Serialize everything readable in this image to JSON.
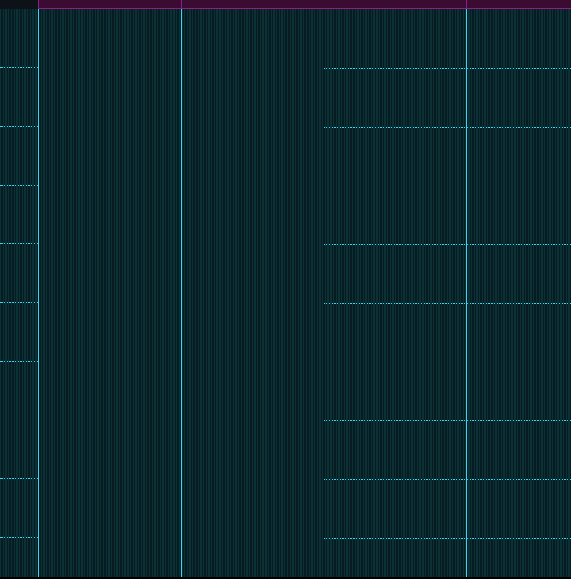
{
  "grid": {
    "columns": 5,
    "rows_in_left_gutter": 10,
    "rows_in_right_panes": 9,
    "colors": {
      "background": "#082428",
      "hatch_light": "#0b3036",
      "hatch_dark": "#061c20",
      "line": "#37d7ee",
      "header": "#3b0b32",
      "header_accent": "#8a1f86"
    }
  }
}
